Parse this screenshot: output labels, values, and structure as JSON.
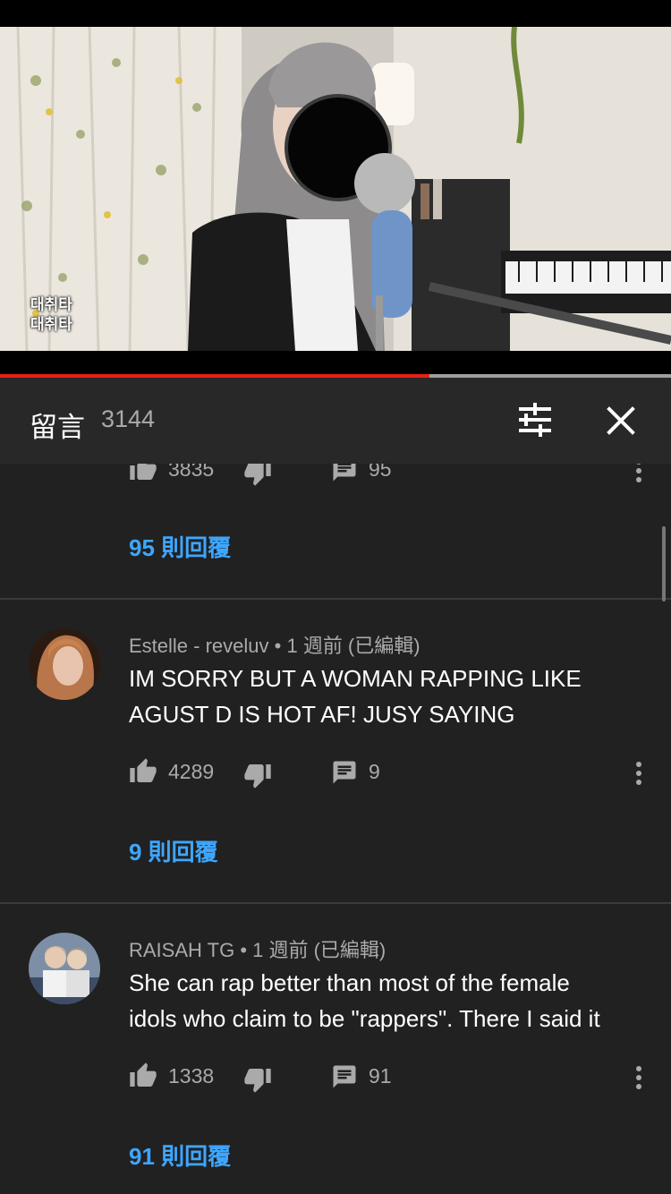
{
  "video": {
    "subtitle_line1": "대취타",
    "subtitle_line2": "대취타",
    "progress_percent": 64
  },
  "comments_panel": {
    "title": "留言",
    "count": "3144"
  },
  "comments": [
    {
      "likes": "3835",
      "replies_count": "95",
      "replies_link": "95 則回覆"
    },
    {
      "author": "Estelle - reveluv",
      "time": "1 週前 (已編輯)",
      "text_line1": "IM SORRY BUT A WOMAN RAPPING LIKE",
      "text_line2": "AGUST D IS HOT AF! JUSY SAYING",
      "likes": "4289",
      "replies_count": "9",
      "replies_link": "9 則回覆"
    },
    {
      "author": "RAISAH TG",
      "time": "1 週前 (已編輯)",
      "text_line1": "She can rap better than most of the female",
      "text_line2": "idols who claim to be \"rappers\". There I said it",
      "likes": "1338",
      "replies_count": "91",
      "replies_link": "91 則回覆"
    }
  ],
  "separator": "•",
  "colors": {
    "accent_blue": "#3ea6ff",
    "progress_red": "#e62117",
    "background": "#212121"
  }
}
